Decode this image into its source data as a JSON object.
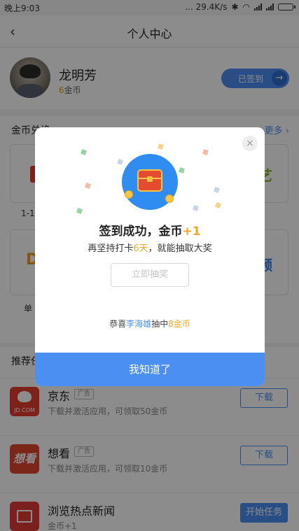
{
  "status_bar": {
    "time": "晚上9:03",
    "speed": "... 29.4K/s"
  },
  "nav": {
    "title": "个人中心"
  },
  "profile": {
    "name": "龙明芳",
    "coins": "6",
    "coins_unit": "金币",
    "signed_label": "已签到"
  },
  "exchange": {
    "title": "金币兑换",
    "more": "更多",
    "left_caption_1": "1-1",
    "left_caption_2": "单",
    "art_logo_text": "艺",
    "pin_logo_text": "频"
  },
  "recommend": {
    "title": "推荐任务",
    "apps": [
      {
        "name": "京东",
        "ad": "广告",
        "desc": "下载并激活应用，可领取50金币",
        "action": "下载",
        "icon_text": "JD.COM"
      },
      {
        "name": "想看",
        "ad": "广告",
        "desc": "下载并激活应用，可领取10金币",
        "action": "下载",
        "icon_text": "想看"
      },
      {
        "name": "浏览热点新闻",
        "ad": "",
        "desc": "金币+1",
        "action": "开始任务",
        "icon_text": ""
      }
    ]
  },
  "modal": {
    "title_prefix": "签到成功，金币",
    "title_plus": "+1",
    "sub_prefix": "再坚持打卡",
    "sub_days": "6天",
    "sub_suffix": "，就能抽取大奖",
    "lottery_label": "立即抽奖",
    "congrats_prefix": "恭喜",
    "congrats_user": "李海雄",
    "congrats_mid": "抽中",
    "congrats_prize": "8金币",
    "ok_label": "我知道了",
    "close_symbol": "×"
  }
}
